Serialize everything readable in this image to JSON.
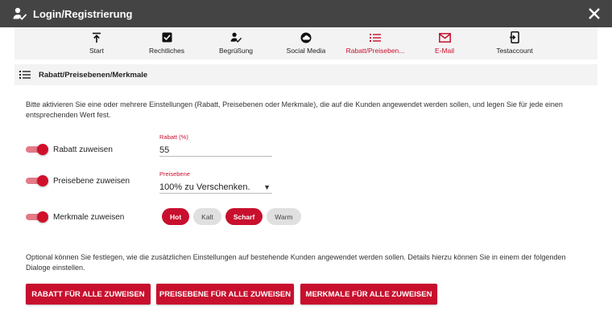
{
  "window": {
    "title": "Login/Registrierung",
    "icon": "user-check-icon",
    "close_icon": "close-icon"
  },
  "steps": [
    {
      "label": "Start",
      "icon": "upload-arrow-icon"
    },
    {
      "label": "Rechtliches",
      "icon": "checkbox-icon"
    },
    {
      "label": "Begrüßung",
      "icon": "user-check-icon"
    },
    {
      "label": "Social Media",
      "icon": "cloud-circle-icon"
    },
    {
      "label": "Rabatt/Preiseben...",
      "icon": "list-icon"
    },
    {
      "label": "E-Mail",
      "icon": "envelope-icon"
    },
    {
      "label": "Testaccount",
      "icon": "phone-login-icon"
    }
  ],
  "active_step": 4,
  "section": {
    "title": "Rabatt/Preisebenen/Merkmale",
    "icon": "list-icon"
  },
  "intro_text": "Bitte aktivieren Sie eine oder mehrere Einstellungen (Rabatt, Preisebenen oder Merkmale), die auf die Kunden angewendet werden sollen, und legen Sie für jede einen entsprechenden Wert fest.",
  "settings": {
    "rabatt": {
      "toggle_label": "Rabatt zuweisen",
      "enabled": true,
      "field_label": "Rabatt (%)",
      "value": "55"
    },
    "preisebene": {
      "toggle_label": "Preisebene zuweisen",
      "enabled": true,
      "field_label": "Preisebene",
      "value": "100% zu Verschenken."
    },
    "merkmale": {
      "toggle_label": "Merkmale zuweisen",
      "enabled": true,
      "chips": [
        {
          "label": "Hot",
          "selected": true
        },
        {
          "label": "Kalt",
          "selected": false
        },
        {
          "label": "Scharf",
          "selected": true
        },
        {
          "label": "Warm",
          "selected": false
        }
      ]
    }
  },
  "optional_text": "Optional können Sie festlegen, wie die zusätzlichen Einstellungen auf bestehende Kunden angewendet werden sollen. Details hierzu können Sie in einem der folgenden Dialoge einstellen.",
  "buttons": {
    "rabatt": "RABATT FÜR ALLE ZUWEISEN",
    "preisebene": "PREISEBENE FÜR ALLE ZUWEISEN",
    "merkmale": "MERKMALE FÜR ALLE ZUWEISEN"
  },
  "colors": {
    "accent": "#c8102e",
    "titlebar": "#444444",
    "panel": "#f3f3f3"
  }
}
